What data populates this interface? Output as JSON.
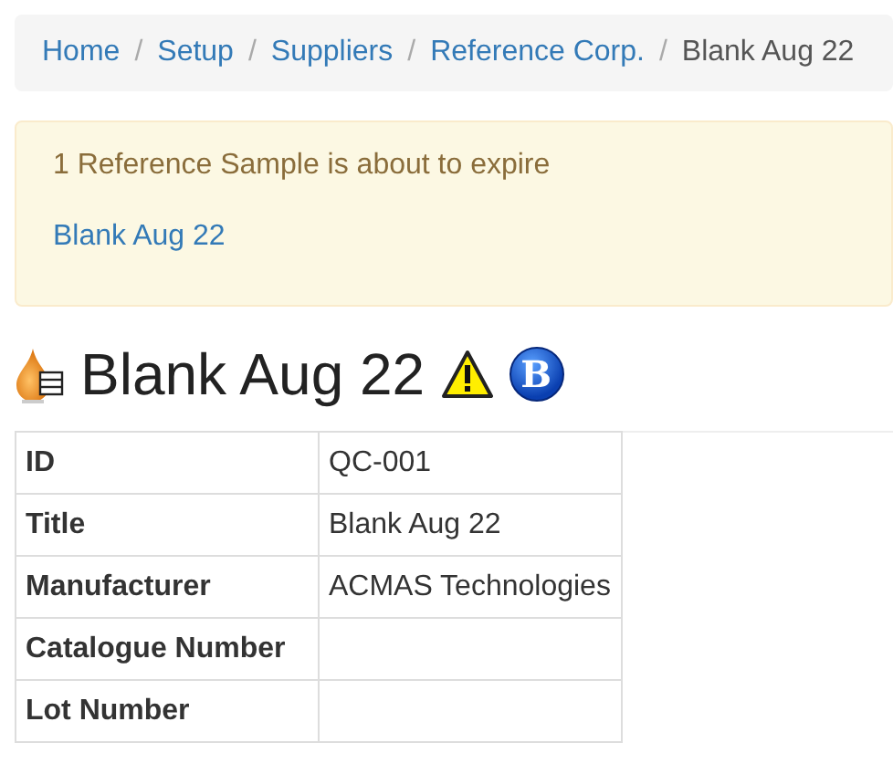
{
  "breadcrumb": [
    {
      "label": "Home",
      "link": true
    },
    {
      "label": "Setup",
      "link": true
    },
    {
      "label": "Suppliers",
      "link": true
    },
    {
      "label": "Reference Corp.",
      "link": true
    },
    {
      "label": "Blank Aug 22",
      "link": false
    }
  ],
  "separator": "/",
  "alert": {
    "message": "1 Reference Sample is about to expire",
    "link": "Blank Aug 22"
  },
  "heading": {
    "title": "Blank Aug 22",
    "badge_letter": "B"
  },
  "table": {
    "rows": [
      {
        "label": "ID",
        "value": "QC-001"
      },
      {
        "label": "Title",
        "value": "Blank Aug 22"
      },
      {
        "label": "Manufacturer",
        "value": "ACMAS Technologies"
      },
      {
        "label": "Catalogue Number"
      },
      {
        "label": "Lot Number"
      }
    ]
  }
}
